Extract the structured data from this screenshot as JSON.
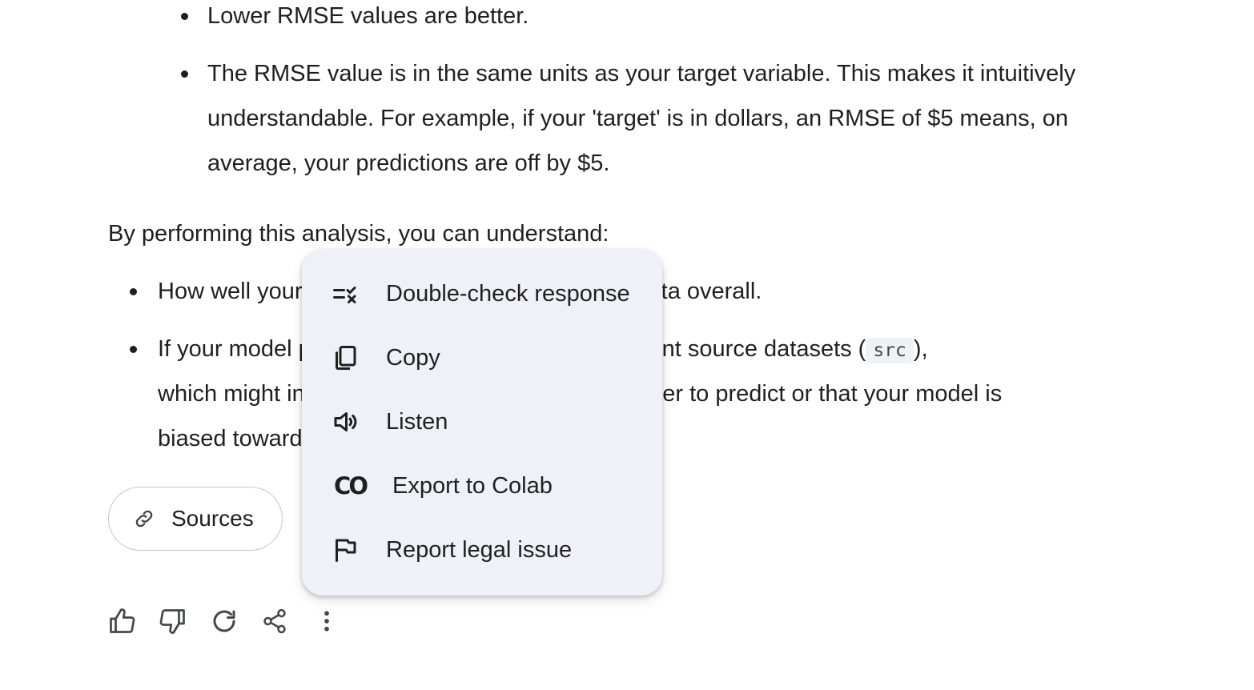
{
  "content": {
    "list1": [
      {
        "lines": [
          "Lower RMSE values are better."
        ]
      },
      {
        "lines": [
          "The RMSE value is in the same units as your target variable. This makes it intuitively",
          "understandable. For example, if your 'target' is in dollars, an RMSE of $5 means, on",
          "average, your predictions are off by $5."
        ]
      }
    ],
    "paragraph": "By performing this analysis, you can understand:",
    "list2": {
      "item1": "How well your model performs on unseen test data overall.",
      "item2_line1_before": "If your model performs significantly across different source datasets (",
      "item2_code": "src",
      "item2_line1_after": "),",
      "item2_line2": "which might indicate that some datasets are harder to predict or that your model is",
      "item2_line3": "biased towards certain data sources."
    }
  },
  "sources_button": {
    "label": "Sources",
    "icon": "link-icon"
  },
  "action_bar": {
    "icons": [
      "thumb-up-icon",
      "thumb-down-icon",
      "redo-icon",
      "share-icon",
      "more-vert-icon"
    ]
  },
  "menu": {
    "items": [
      {
        "label": "Double-check response",
        "icon": "double-check-icon"
      },
      {
        "label": "Copy",
        "icon": "copy-icon"
      },
      {
        "label": "Listen",
        "icon": "speaker-icon"
      },
      {
        "label": "Export to Colab",
        "icon": "colab-icon",
        "glyph": "CO"
      },
      {
        "label": "Report legal issue",
        "icon": "flag-icon"
      }
    ]
  },
  "colors": {
    "text": "#1f1f1f",
    "menu_background": "#eef2f8",
    "icon": "#444746",
    "code_background": "#eef1f6",
    "border": "#c4c7c5"
  }
}
